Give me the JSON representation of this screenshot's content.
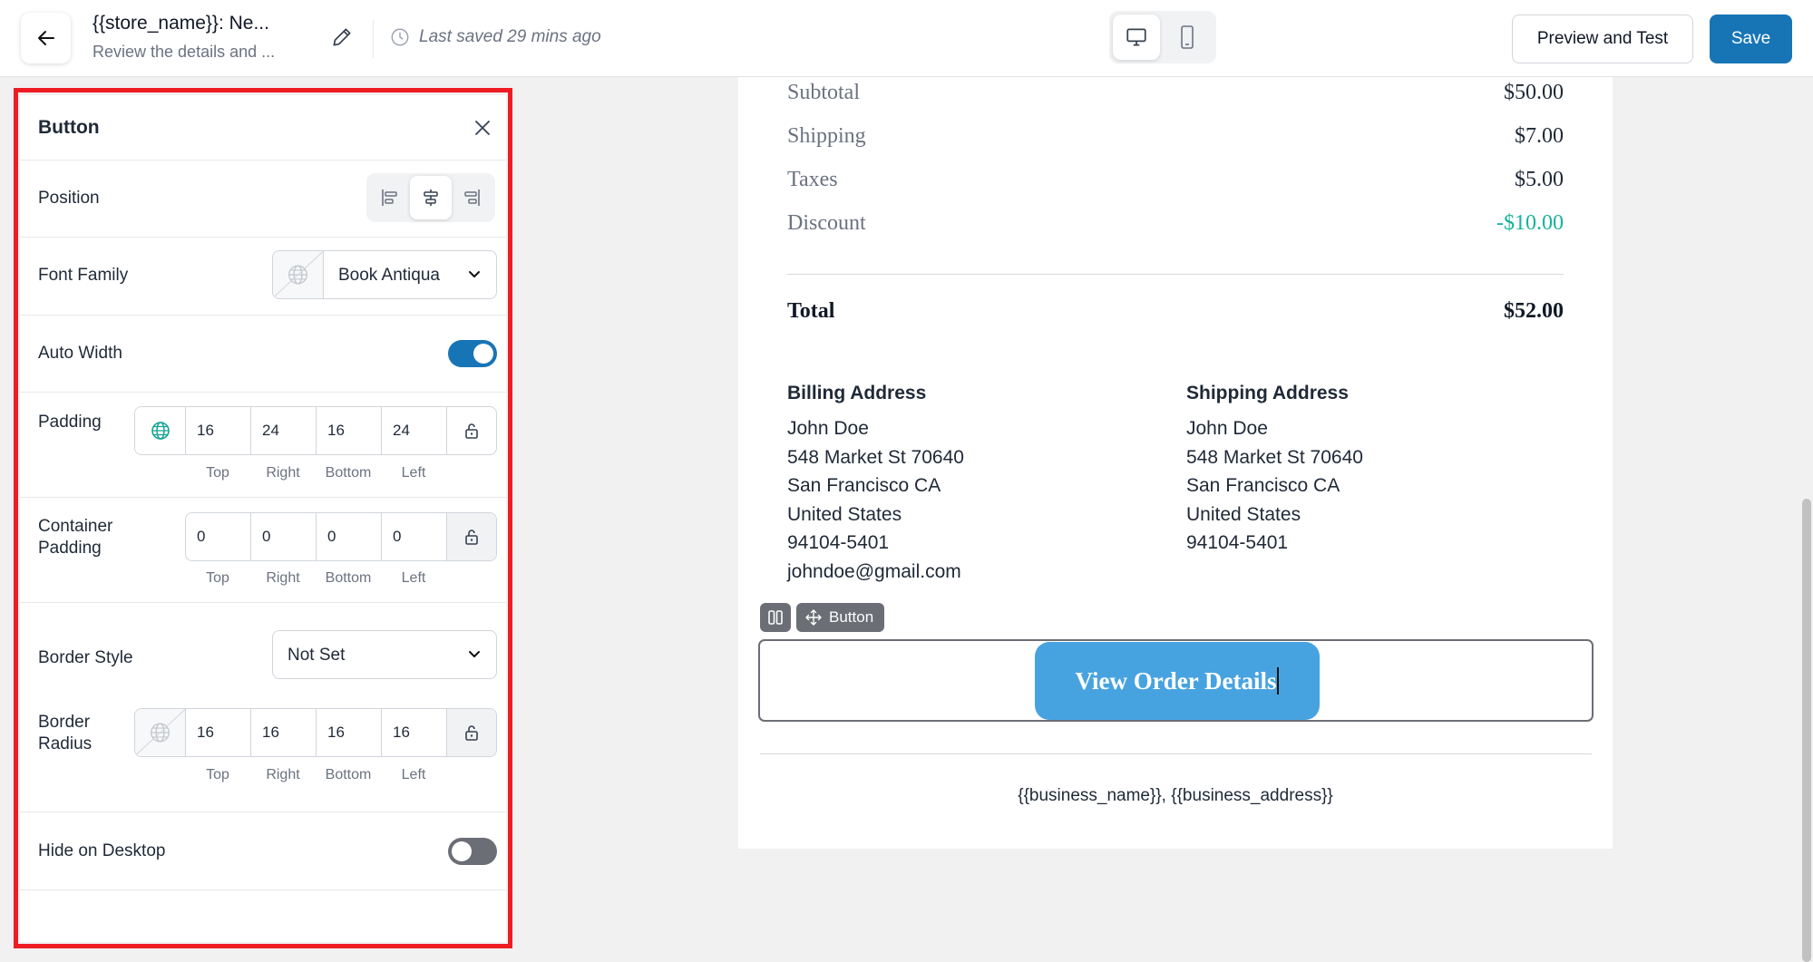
{
  "header": {
    "title": "{{store_name}}: Ne...",
    "subtitle": "Review the details and ...",
    "saved_text": "Last saved 29 mins ago",
    "preview_label": "Preview and Test",
    "save_label": "Save"
  },
  "panel": {
    "title": "Button",
    "position": {
      "label": "Position",
      "selected": "center"
    },
    "font_family": {
      "label": "Font Family",
      "value": "Book Antiqua"
    },
    "auto_width": {
      "label": "Auto Width",
      "enabled": true
    },
    "padding": {
      "label": "Padding",
      "top": "16",
      "right": "24",
      "bottom": "16",
      "left": "24"
    },
    "container_padding": {
      "label": "Container Padding",
      "label_line1": "Container",
      "label_line2": "Padding",
      "top": "0",
      "right": "0",
      "bottom": "0",
      "left": "0"
    },
    "border_style": {
      "label": "Border Style",
      "value": "Not Set"
    },
    "border_radius": {
      "label": "Border Radius",
      "label_line1": "Border",
      "label_line2": "Radius",
      "top": "16",
      "right": "16",
      "bottom": "16",
      "left": "16"
    },
    "hide_on_desktop": {
      "label": "Hide on Desktop",
      "enabled": false
    },
    "side_labels": {
      "top": "Top",
      "right": "Right",
      "bottom": "Bottom",
      "left": "Left"
    }
  },
  "email": {
    "summary": [
      {
        "label": "Subtotal",
        "amount": "$50.00"
      },
      {
        "label": "Shipping",
        "amount": "$7.00"
      },
      {
        "label": "Taxes",
        "amount": "$5.00"
      },
      {
        "label": "Discount",
        "amount": "-$10.00"
      }
    ],
    "total_label": "Total",
    "total_amount": "$52.00",
    "billing": {
      "heading": "Billing Address",
      "lines": [
        "John Doe",
        "548 Market St 70640",
        "San Francisco CA",
        "United States",
        "94104-5401",
        "johndoe@gmail.com"
      ]
    },
    "shipping": {
      "heading": "Shipping Address",
      "lines": [
        "John Doe",
        "548 Market St 70640",
        "San Francisco CA",
        "United States",
        "94104-5401"
      ]
    },
    "block_tag": "Button",
    "button_text": "View Order Details",
    "footer": "{{business_name}}, {{business_address}}"
  },
  "colors": {
    "primary": "#1775b6",
    "cta": "#47a3e0",
    "discount": "#15b39a",
    "highlight_frame": "#ee1d23"
  }
}
